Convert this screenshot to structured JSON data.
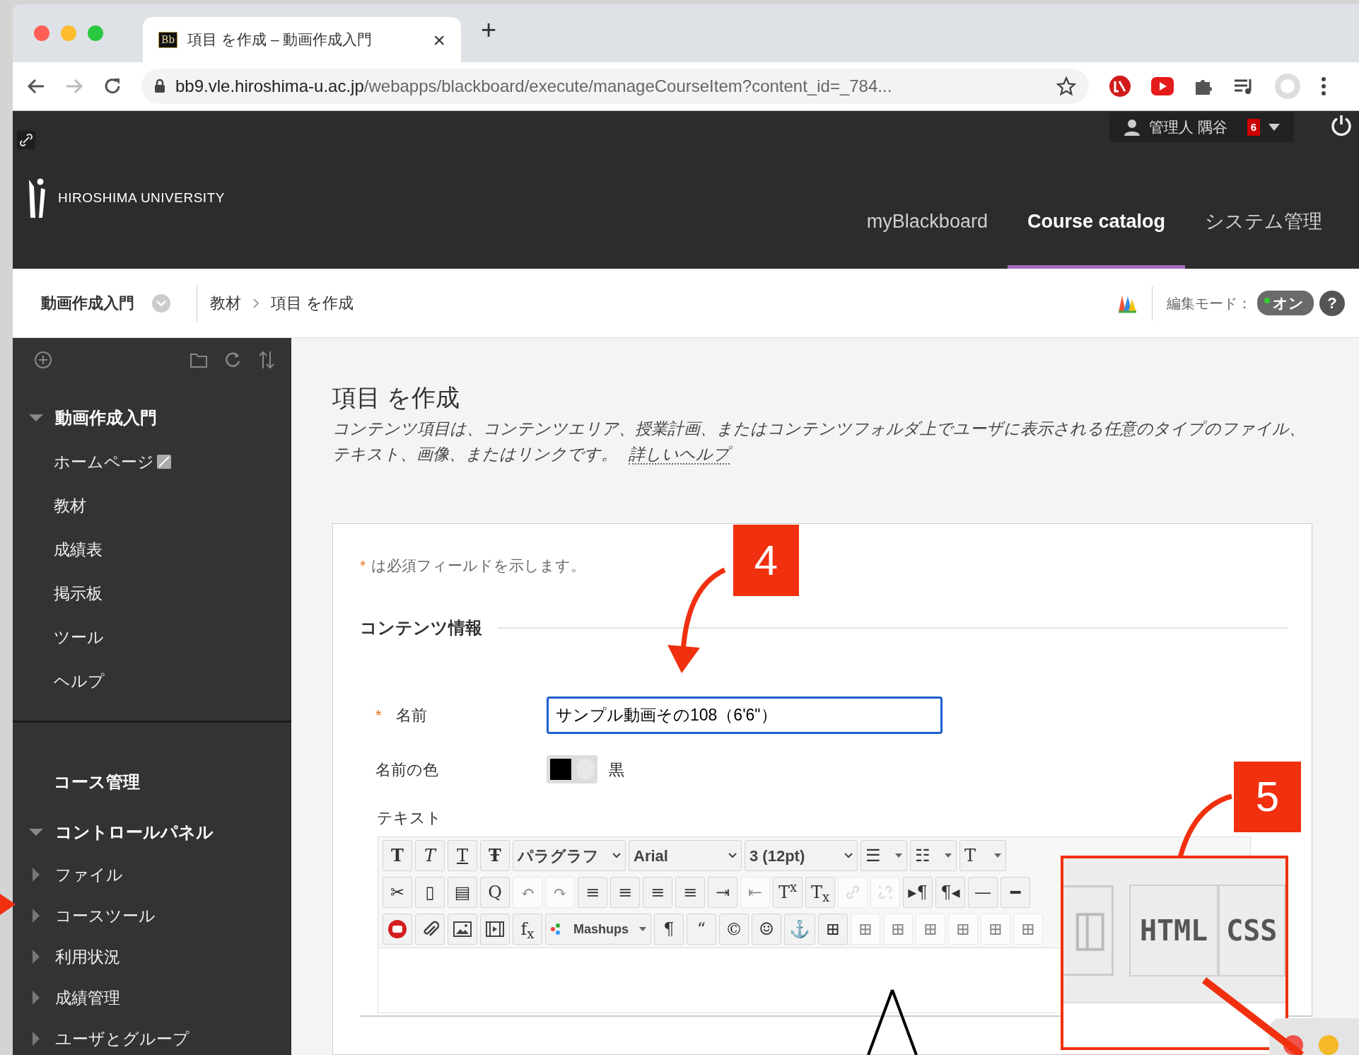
{
  "browser": {
    "tab": {
      "favicon_text": "Bb",
      "title": "項目 を作成 – 動画作成入門",
      "close": "×"
    },
    "new_tab": "+",
    "url": {
      "host": "bb9.vle.hiroshima-u.ac.jp",
      "path": "/webapps/blackboard/execute/manageCourseItem?content_id=_784..."
    }
  },
  "header": {
    "user": "管理人 隅谷",
    "notifications": "6",
    "logo_text": "HIROSHIMA UNIVERSITY",
    "nav": [
      {
        "label": "myBlackboard",
        "selected": false
      },
      {
        "label": "Course catalog",
        "selected": true
      },
      {
        "label": "システム管理",
        "selected": false
      }
    ]
  },
  "breadcrumb": {
    "course": "動画作成入門",
    "crumbs": [
      "教材",
      "項目 を作成"
    ],
    "edit_mode_label": "編集モード：",
    "edit_mode": {
      "label": "オン",
      "on": true
    },
    "help": "?"
  },
  "sidebar": {
    "course": {
      "title": "動画作成入門",
      "expanded": true,
      "items": [
        {
          "label": "ホームページ",
          "badge": true
        },
        {
          "label": "教材",
          "badge": false
        },
        {
          "label": "成績表",
          "badge": false
        },
        {
          "label": "掲示板",
          "badge": false
        },
        {
          "label": "ツール",
          "badge": false
        },
        {
          "label": "ヘルプ",
          "badge": false
        }
      ]
    },
    "management_title": "コース管理",
    "control_panel": {
      "title": "コントロールパネル",
      "expanded": true,
      "items": [
        {
          "label": "ファイル",
          "expanded": false
        },
        {
          "label": "コースツール",
          "expanded": false
        },
        {
          "label": "利用状況",
          "expanded": false
        },
        {
          "label": "成績管理",
          "expanded": false
        },
        {
          "label": "ユーザとグループ",
          "expanded": false
        }
      ]
    }
  },
  "page": {
    "title": "項目 を作成",
    "description": "コンテンツ項目は、コンテンツエリア、授業計画、またはコンテンツフォルダ上でユーザに表示される任意のタイプのファイル、テキスト、画像、またはリンクです。",
    "help_link": "詳しいヘルプ",
    "required_mark": "*",
    "required_note": "は必須フィールドを示します。",
    "section": "コンテンツ情報",
    "name_field": {
      "label": "名前",
      "required": true,
      "value": "サンプル動画その108（6'6\"）"
    },
    "color_field": {
      "label": "名前の色",
      "color": "#000000",
      "value": "黒"
    },
    "text_label": "テキスト",
    "toolbar": [
      [
        {
          "kind": "bold",
          "text": "T",
          "disabled": false
        },
        {
          "kind": "italic",
          "text": "T",
          "disabled": false
        },
        {
          "kind": "underline",
          "text": "T",
          "disabled": false
        },
        {
          "kind": "strike",
          "text": "Ŧ",
          "disabled": false
        },
        {
          "kind": "select",
          "text": "パラグラフ",
          "disabled": false
        },
        {
          "kind": "select",
          "text": "Arial",
          "disabled": false
        },
        {
          "kind": "select",
          "text": "3 (12pt)",
          "disabled": false
        },
        {
          "kind": "split",
          "text": "☰",
          "disabled": false
        },
        {
          "kind": "split",
          "text": "☷",
          "disabled": false
        },
        {
          "kind": "split",
          "text": "T",
          "disabled": false
        }
      ],
      [
        {
          "kind": "glyph",
          "text": "✂",
          "disabled": false
        },
        {
          "kind": "glyph",
          "text": "▯",
          "disabled": false
        },
        {
          "kind": "glyph",
          "text": "▤",
          "disabled": false
        },
        {
          "kind": "glyph",
          "text": "Q",
          "disabled": false
        },
        {
          "kind": "glyph",
          "text": "↶",
          "disabled": true
        },
        {
          "kind": "glyph",
          "text": "↷",
          "disabled": true
        },
        {
          "kind": "glyph",
          "text": "≡",
          "disabled": false
        },
        {
          "kind": "glyph",
          "text": "≡",
          "disabled": false
        },
        {
          "kind": "glyph",
          "text": "≡",
          "disabled": false
        },
        {
          "kind": "glyph",
          "text": "≡",
          "disabled": false
        },
        {
          "kind": "glyph",
          "text": "⇥",
          "disabled": false
        },
        {
          "kind": "glyph",
          "text": "⇤",
          "disabled": true
        },
        {
          "kind": "glyph",
          "text": "T$^{x}$",
          "disabled": false
        },
        {
          "kind": "glyph",
          "text": "T$_{x}$",
          "disabled": false
        },
        {
          "kind": "link",
          "disabled": true
        },
        {
          "kind": "unlink",
          "disabled": true
        },
        {
          "kind": "glyph",
          "text": "▸¶",
          "disabled": false
        },
        {
          "kind": "glyph",
          "text": "¶◂",
          "disabled": false
        },
        {
          "kind": "glyph",
          "text": "—",
          "disabled": false
        },
        {
          "kind": "glyph",
          "text": "━",
          "disabled": false
        }
      ],
      [
        {
          "kind": "youtube",
          "disabled": false
        },
        {
          "kind": "clip",
          "disabled": false
        },
        {
          "kind": "image",
          "disabled": false
        },
        {
          "kind": "media",
          "disabled": false
        },
        {
          "kind": "glyph",
          "text": "f$_{x}$",
          "disabled": false
        },
        {
          "kind": "mashups",
          "text": "Mashups",
          "disabled": false
        },
        {
          "kind": "glyph",
          "text": "¶",
          "disabled": false
        },
        {
          "kind": "glyph",
          "text": "“",
          "disabled": false
        },
        {
          "kind": "glyph",
          "text": "©",
          "disabled": false
        },
        {
          "kind": "glyph",
          "text": "☺",
          "disabled": false
        },
        {
          "kind": "glyph",
          "text": "⚓",
          "disabled": false
        },
        {
          "kind": "glyph",
          "text": "⊞",
          "disabled": false
        },
        {
          "kind": "glyph",
          "text": "⊞",
          "disabled": true
        },
        {
          "kind": "glyph",
          "text": "⊞",
          "disabled": true
        },
        {
          "kind": "glyph",
          "text": "⊞",
          "disabled": true
        },
        {
          "kind": "glyph",
          "text": "⊞",
          "disabled": true
        },
        {
          "kind": "glyph",
          "text": "⊞",
          "disabled": true
        },
        {
          "kind": "glyph",
          "text": "⊞",
          "disabled": true
        }
      ]
    ]
  },
  "annotations": [
    {
      "kind": "step",
      "label": "4"
    },
    {
      "kind": "step",
      "label": "5"
    }
  ],
  "zoom_inset": {
    "buttons": [
      "HTML",
      "CSS"
    ]
  }
}
